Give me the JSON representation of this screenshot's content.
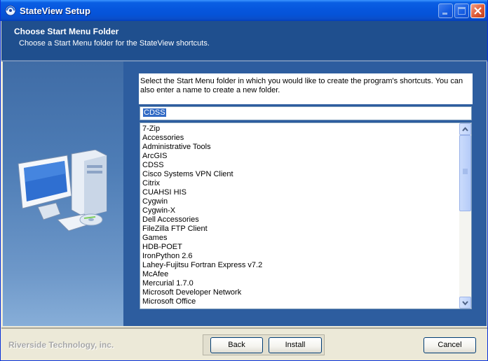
{
  "window": {
    "title": "StateView Setup"
  },
  "header": {
    "title": "Choose Start Menu Folder",
    "subtitle": "Choose a Start Menu folder for the StateView shortcuts."
  },
  "instructions": "Select the Start Menu folder in which you would like to create the program's shortcuts. You can also enter a name to create a new folder.",
  "folder_input": {
    "value": "CDSS"
  },
  "folder_list": {
    "items": [
      "7-Zip",
      "Accessories",
      "Administrative Tools",
      "ArcGIS",
      "CDSS",
      "Cisco Systems VPN Client",
      "Citrix",
      "CUAHSI HIS",
      "Cygwin",
      "Cygwin-X",
      "Dell Accessories",
      "FileZilla FTP Client",
      "Games",
      "HDB-POET",
      "IronPython 2.6",
      "Lahey-Fujitsu Fortran Express v7.2",
      "McAfee",
      "Mercurial 1.7.0",
      "Microsoft Developer Network",
      "Microsoft Office"
    ]
  },
  "footer": {
    "company": "Riverside Technology, inc.",
    "back_label": "Back",
    "install_label": "Install",
    "cancel_label": "Cancel"
  },
  "colors": {
    "title_bar": "#0553d8",
    "header_band": "#1f4f8e",
    "content_band": "#2d5d9f",
    "selection": "#316ac5"
  },
  "icons": [
    "setup-app-icon",
    "minimize-icon",
    "maximize-icon",
    "close-icon",
    "scroll-up-icon",
    "scroll-down-icon",
    "computer-illustration"
  ]
}
